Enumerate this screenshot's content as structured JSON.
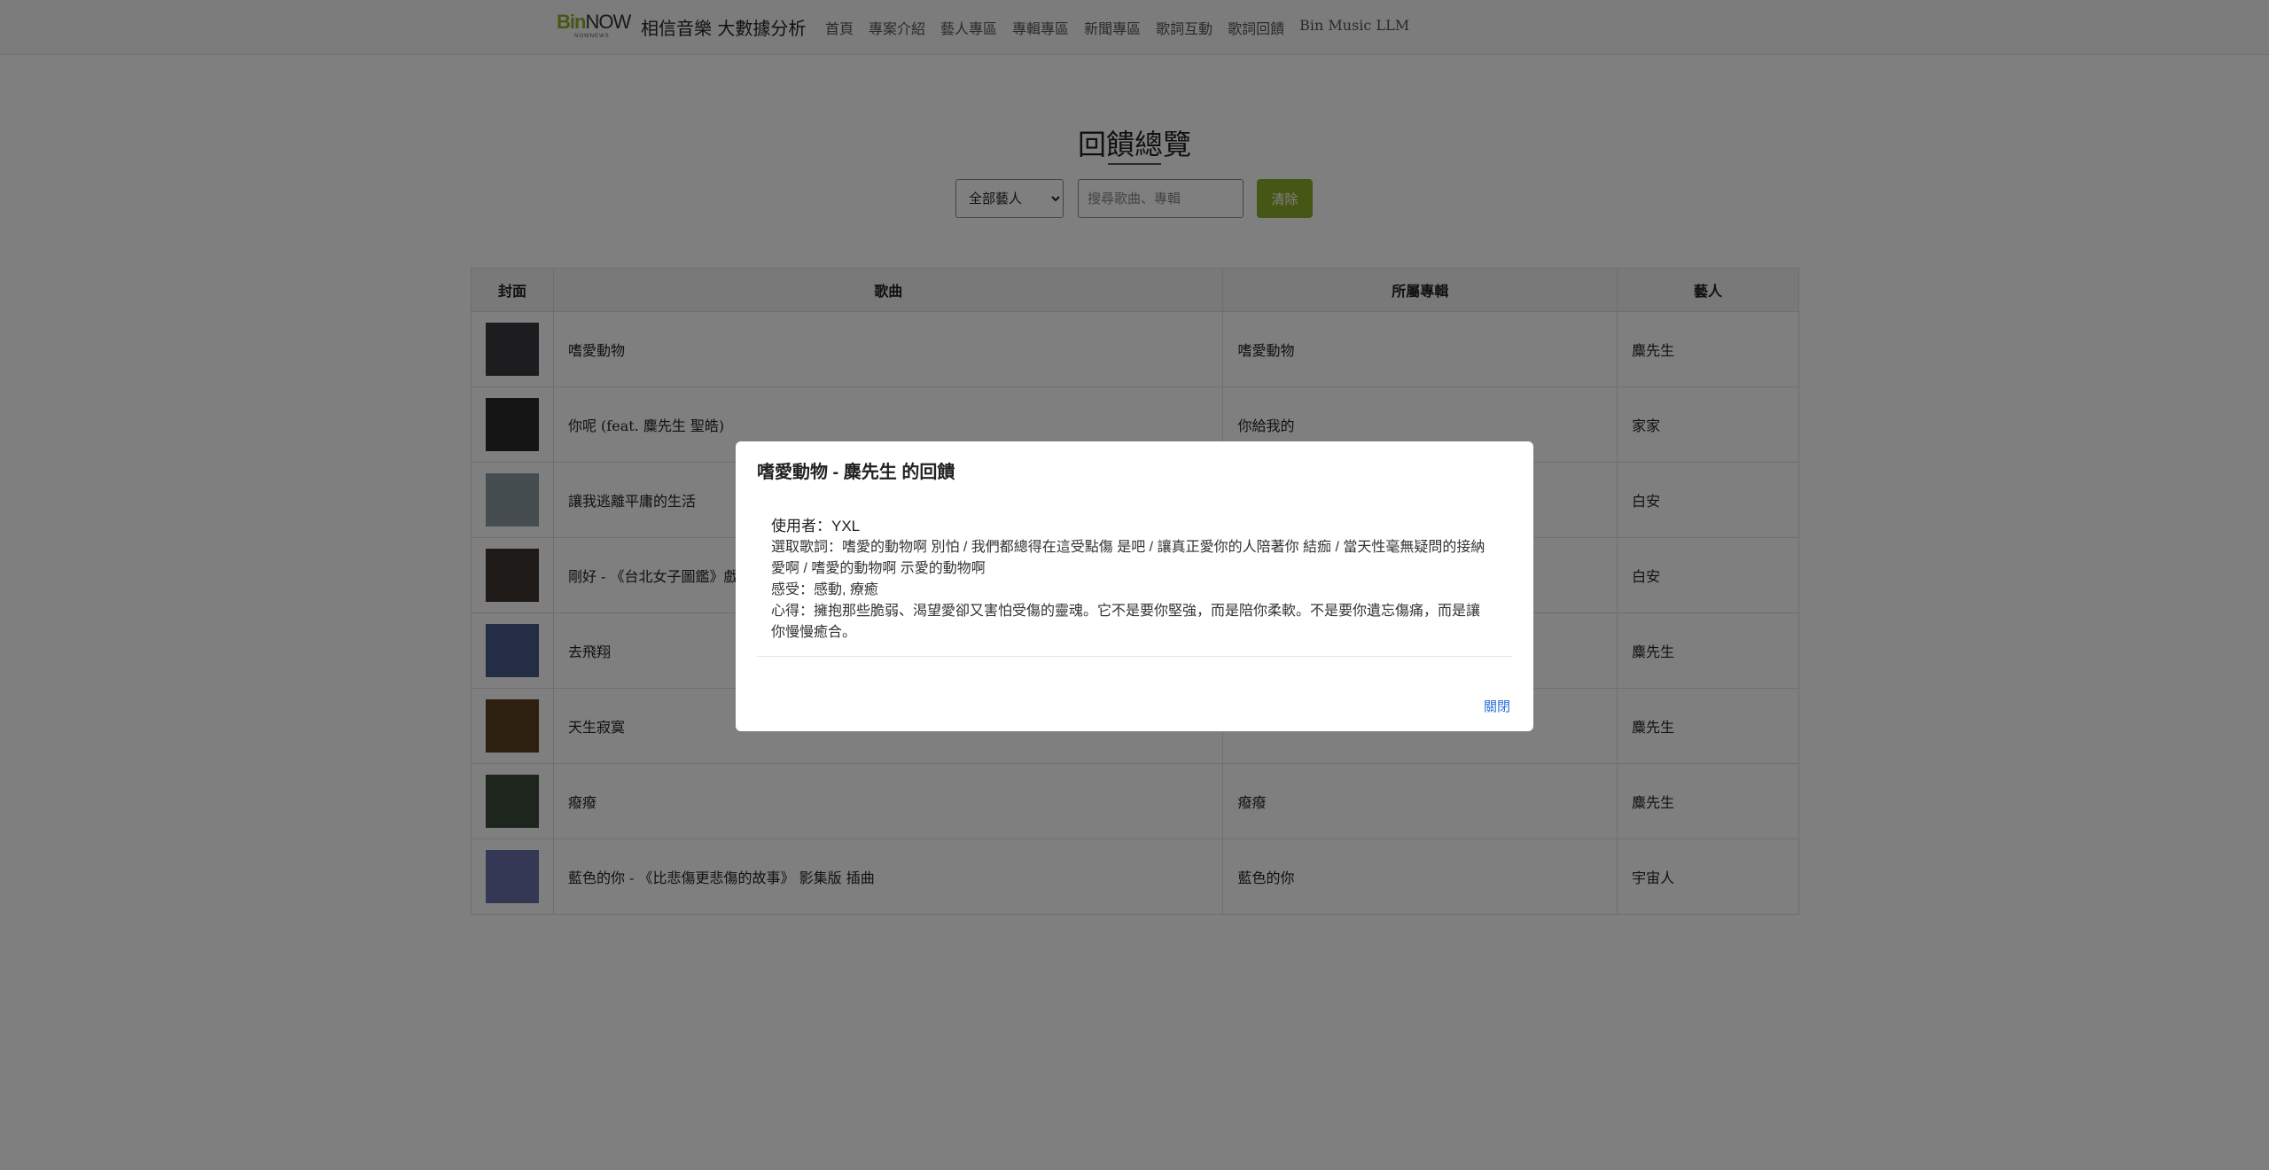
{
  "navbar": {
    "logo": {
      "bin": "Bin",
      "now": "NOW",
      "sub": "NOWNEWS"
    },
    "site_title": "相信音樂 大數據分析",
    "links": [
      "首頁",
      "專案介紹",
      "藝人專區",
      "專輯專區",
      "新聞專區",
      "歌詞互動",
      "歌詞回饋",
      "Bin Music LLM"
    ]
  },
  "page": {
    "title": "回饋總覽",
    "artist_filter": {
      "selected": "全部藝人"
    },
    "search": {
      "placeholder": "搜尋歌曲、專輯",
      "value": ""
    },
    "clear_label": "清除"
  },
  "table": {
    "headers": {
      "cover": "封面",
      "song": "歌曲",
      "album": "所屬專輯",
      "artist": "藝人"
    },
    "rows": [
      {
        "song": "嗜愛動物",
        "album": "嗜愛動物",
        "artist": "麋先生",
        "cover_color": "#3a3a3e"
      },
      {
        "song": "你呢 (feat. 麋先生 聖皓)",
        "album": "你給我的",
        "artist": "家家",
        "cover_color": "#2d2a2a"
      },
      {
        "song": "讓我逃離平庸的生活",
        "album": "",
        "artist": "白安",
        "cover_color": "#8a9aa0"
      },
      {
        "song": "剛好 - 《台北女子圖鑑》戲",
        "album": "",
        "artist": "白安",
        "cover_color": "#3b3530"
      },
      {
        "song": "去飛翔",
        "album": "",
        "artist": "麋先生",
        "cover_color": "#4a5a8a"
      },
      {
        "song": "天生寂寞",
        "album": "",
        "artist": "麋先生",
        "cover_color": "#5a4020"
      },
      {
        "song": "癈癈",
        "album": "癈癈",
        "artist": "麋先生",
        "cover_color": "#3a4a3a"
      },
      {
        "song": "藍色的你 - 《比悲傷更悲傷的故事》 影集版 插曲",
        "album": "藍色的你",
        "artist": "宇宙人",
        "cover_color": "#6a70a8"
      }
    ]
  },
  "modal": {
    "title": "嗜愛動物 - 麋先生 的回饋",
    "user": "使用者：YXL",
    "lyrics": "選取歌詞：嗜愛的動物啊 別怕 / 我們都總得在這受點傷 是吧 / 讓真正愛你的人陪著你 結痂 / 當天性毫無疑問的接納",
    "lyrics_cont": "愛啊 / 嗜愛的動物啊 示愛的動物啊",
    "feeling": "感受：感動, 療癒",
    "thoughts": "心得：擁抱那些脆弱、渴望愛卻又害怕受傷的靈魂。它不是要你堅強，而是陪你柔軟。不是要你遺忘傷痛，而是讓",
    "thoughts_cont": "你慢慢癒合。",
    "close_label": "關閉"
  }
}
